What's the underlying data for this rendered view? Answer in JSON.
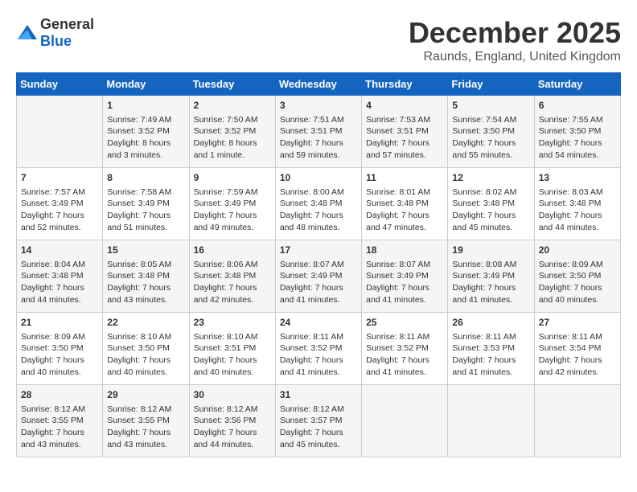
{
  "header": {
    "logo_general": "General",
    "logo_blue": "Blue",
    "month_title": "December 2025",
    "location": "Raunds, England, United Kingdom"
  },
  "days_of_week": [
    "Sunday",
    "Monday",
    "Tuesday",
    "Wednesday",
    "Thursday",
    "Friday",
    "Saturday"
  ],
  "weeks": [
    [
      {
        "day": "",
        "info": ""
      },
      {
        "day": "1",
        "info": "Sunrise: 7:49 AM\nSunset: 3:52 PM\nDaylight: 8 hours\nand 3 minutes."
      },
      {
        "day": "2",
        "info": "Sunrise: 7:50 AM\nSunset: 3:52 PM\nDaylight: 8 hours\nand 1 minute."
      },
      {
        "day": "3",
        "info": "Sunrise: 7:51 AM\nSunset: 3:51 PM\nDaylight: 7 hours\nand 59 minutes."
      },
      {
        "day": "4",
        "info": "Sunrise: 7:53 AM\nSunset: 3:51 PM\nDaylight: 7 hours\nand 57 minutes."
      },
      {
        "day": "5",
        "info": "Sunrise: 7:54 AM\nSunset: 3:50 PM\nDaylight: 7 hours\nand 55 minutes."
      },
      {
        "day": "6",
        "info": "Sunrise: 7:55 AM\nSunset: 3:50 PM\nDaylight: 7 hours\nand 54 minutes."
      }
    ],
    [
      {
        "day": "7",
        "info": "Sunrise: 7:57 AM\nSunset: 3:49 PM\nDaylight: 7 hours\nand 52 minutes."
      },
      {
        "day": "8",
        "info": "Sunrise: 7:58 AM\nSunset: 3:49 PM\nDaylight: 7 hours\nand 51 minutes."
      },
      {
        "day": "9",
        "info": "Sunrise: 7:59 AM\nSunset: 3:49 PM\nDaylight: 7 hours\nand 49 minutes."
      },
      {
        "day": "10",
        "info": "Sunrise: 8:00 AM\nSunset: 3:48 PM\nDaylight: 7 hours\nand 48 minutes."
      },
      {
        "day": "11",
        "info": "Sunrise: 8:01 AM\nSunset: 3:48 PM\nDaylight: 7 hours\nand 47 minutes."
      },
      {
        "day": "12",
        "info": "Sunrise: 8:02 AM\nSunset: 3:48 PM\nDaylight: 7 hours\nand 45 minutes."
      },
      {
        "day": "13",
        "info": "Sunrise: 8:03 AM\nSunset: 3:48 PM\nDaylight: 7 hours\nand 44 minutes."
      }
    ],
    [
      {
        "day": "14",
        "info": "Sunrise: 8:04 AM\nSunset: 3:48 PM\nDaylight: 7 hours\nand 44 minutes."
      },
      {
        "day": "15",
        "info": "Sunrise: 8:05 AM\nSunset: 3:48 PM\nDaylight: 7 hours\nand 43 minutes."
      },
      {
        "day": "16",
        "info": "Sunrise: 8:06 AM\nSunset: 3:48 PM\nDaylight: 7 hours\nand 42 minutes."
      },
      {
        "day": "17",
        "info": "Sunrise: 8:07 AM\nSunset: 3:49 PM\nDaylight: 7 hours\nand 41 minutes."
      },
      {
        "day": "18",
        "info": "Sunrise: 8:07 AM\nSunset: 3:49 PM\nDaylight: 7 hours\nand 41 minutes."
      },
      {
        "day": "19",
        "info": "Sunrise: 8:08 AM\nSunset: 3:49 PM\nDaylight: 7 hours\nand 41 minutes."
      },
      {
        "day": "20",
        "info": "Sunrise: 8:09 AM\nSunset: 3:50 PM\nDaylight: 7 hours\nand 40 minutes."
      }
    ],
    [
      {
        "day": "21",
        "info": "Sunrise: 8:09 AM\nSunset: 3:50 PM\nDaylight: 7 hours\nand 40 minutes."
      },
      {
        "day": "22",
        "info": "Sunrise: 8:10 AM\nSunset: 3:50 PM\nDaylight: 7 hours\nand 40 minutes."
      },
      {
        "day": "23",
        "info": "Sunrise: 8:10 AM\nSunset: 3:51 PM\nDaylight: 7 hours\nand 40 minutes."
      },
      {
        "day": "24",
        "info": "Sunrise: 8:11 AM\nSunset: 3:52 PM\nDaylight: 7 hours\nand 41 minutes."
      },
      {
        "day": "25",
        "info": "Sunrise: 8:11 AM\nSunset: 3:52 PM\nDaylight: 7 hours\nand 41 minutes."
      },
      {
        "day": "26",
        "info": "Sunrise: 8:11 AM\nSunset: 3:53 PM\nDaylight: 7 hours\nand 41 minutes."
      },
      {
        "day": "27",
        "info": "Sunrise: 8:11 AM\nSunset: 3:54 PM\nDaylight: 7 hours\nand 42 minutes."
      }
    ],
    [
      {
        "day": "28",
        "info": "Sunrise: 8:12 AM\nSunset: 3:55 PM\nDaylight: 7 hours\nand 43 minutes."
      },
      {
        "day": "29",
        "info": "Sunrise: 8:12 AM\nSunset: 3:55 PM\nDaylight: 7 hours\nand 43 minutes."
      },
      {
        "day": "30",
        "info": "Sunrise: 8:12 AM\nSunset: 3:56 PM\nDaylight: 7 hours\nand 44 minutes."
      },
      {
        "day": "31",
        "info": "Sunrise: 8:12 AM\nSunset: 3:57 PM\nDaylight: 7 hours\nand 45 minutes."
      },
      {
        "day": "",
        "info": ""
      },
      {
        "day": "",
        "info": ""
      },
      {
        "day": "",
        "info": ""
      }
    ]
  ]
}
